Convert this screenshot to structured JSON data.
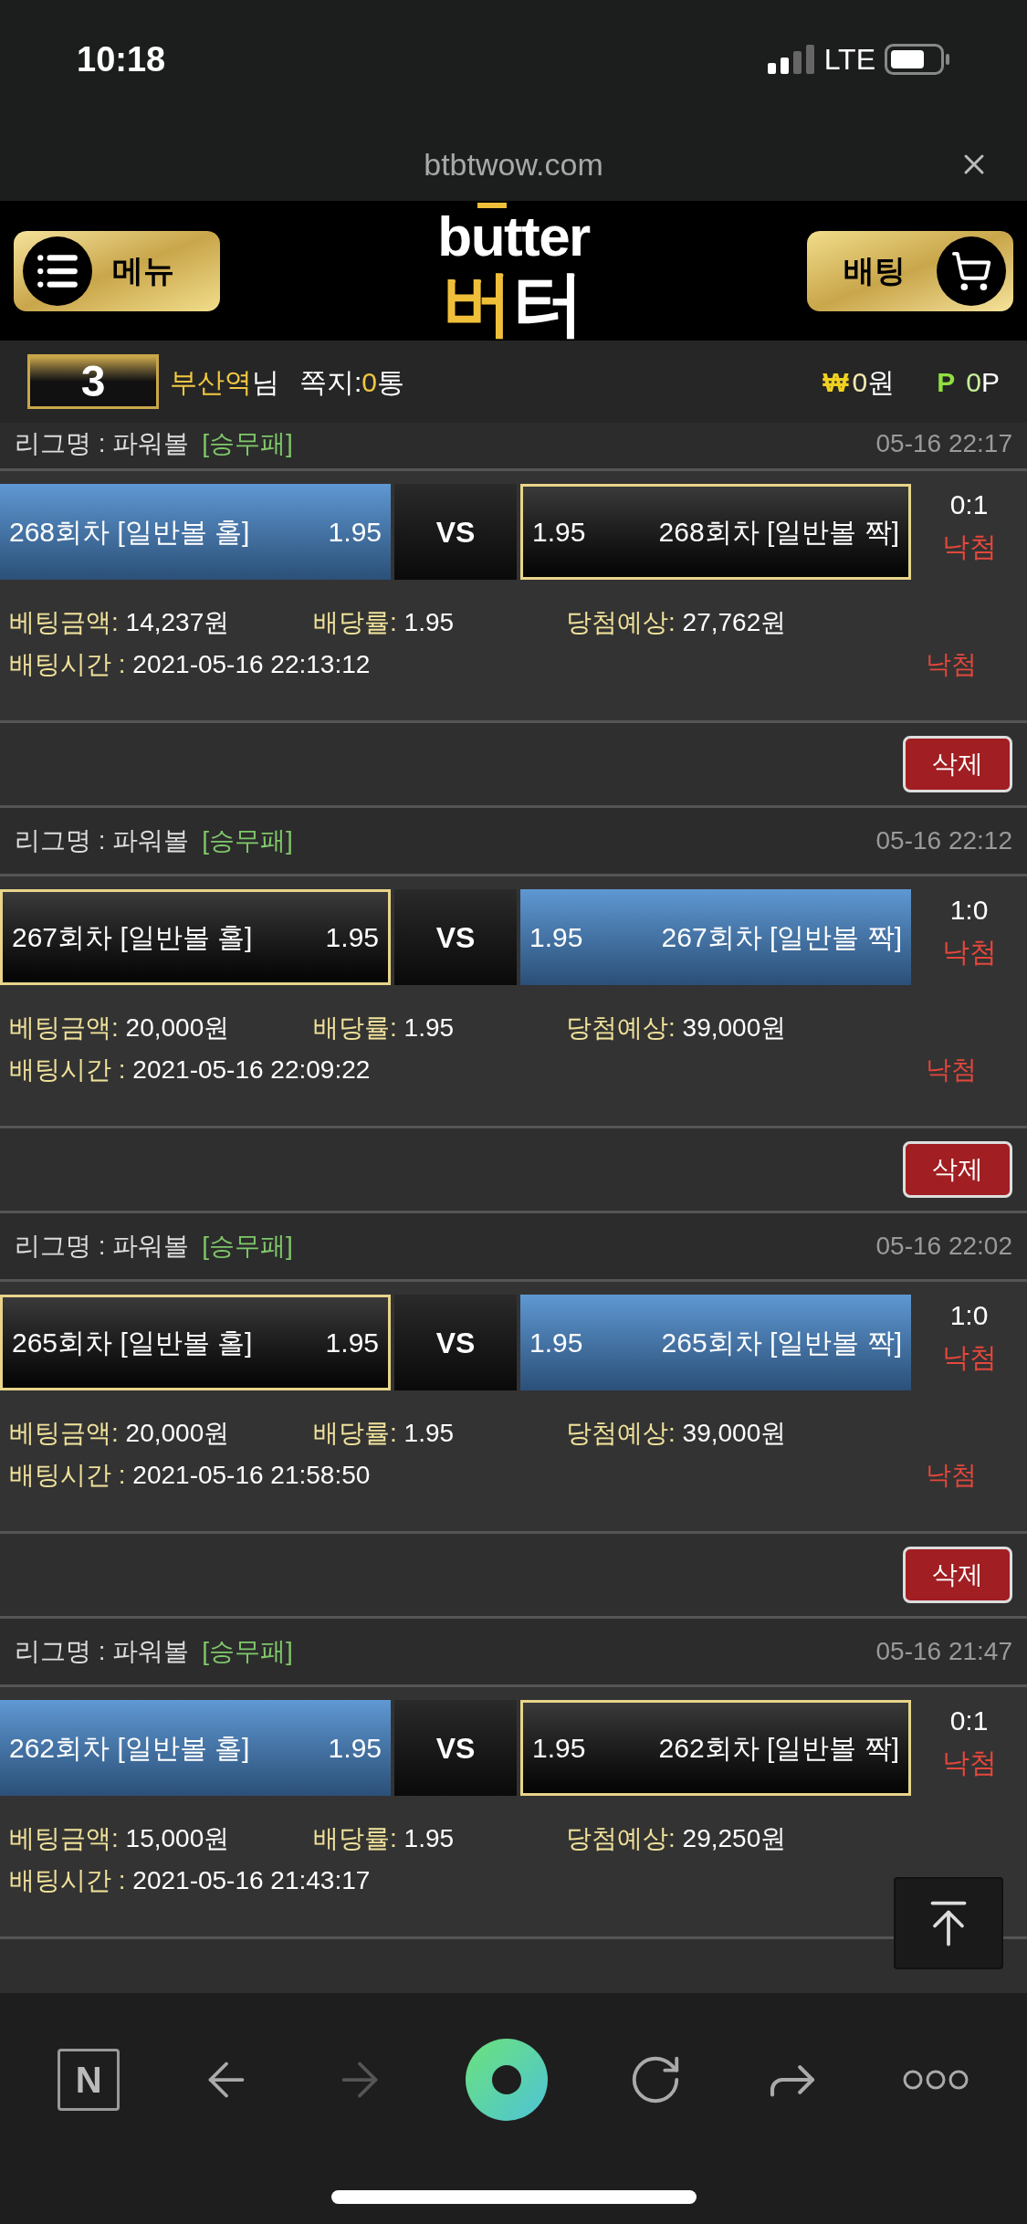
{
  "status_bar": {
    "time": "10:18",
    "network": "LTE"
  },
  "browser": {
    "url": "btbtwow.com"
  },
  "header": {
    "menu_button": "메뉴",
    "logo_top": "butter",
    "logo_bottom": [
      "버",
      "터"
    ],
    "bet_button": "배팅"
  },
  "user_bar": {
    "level": "3",
    "nickname": "부산역",
    "honorific": "님",
    "messages_label": "쪽지:",
    "messages_count": "0",
    "messages_unit": "통",
    "money_symbol": "₩",
    "money_value": "0",
    "money_unit": "원",
    "points_symbol": "P",
    "points_value": "0",
    "points_unit": "P"
  },
  "bets": [
    {
      "league_label": "리그명 : 파워볼",
      "market": "[승무패]",
      "time": "05-16 22:17",
      "home": {
        "label": "268회차 [일반볼 홀]",
        "odds": "1.95",
        "selected": false
      },
      "vs": "VS",
      "away": {
        "label": "268회차 [일반볼 짝]",
        "odds": "1.95",
        "selected": true
      },
      "score": "0:1",
      "result": "낙첨",
      "amount_label": "베팅금액:",
      "amount": "14,237원",
      "odds_label": "배당률:",
      "odds": "1.95",
      "expected_label": "당첨예상:",
      "expected": "27,762원",
      "bet_time_label": "배팅시간 :",
      "bet_time": "2021-05-16 22:13:12",
      "status": "낙첨",
      "delete": "삭제"
    },
    {
      "league_label": "리그명 : 파워볼",
      "market": "[승무패]",
      "time": "05-16 22:12",
      "home": {
        "label": "267회차 [일반볼 홀]",
        "odds": "1.95",
        "selected": true
      },
      "vs": "VS",
      "away": {
        "label": "267회차 [일반볼 짝]",
        "odds": "1.95",
        "selected": false
      },
      "score": "1:0",
      "result": "낙첨",
      "amount_label": "베팅금액:",
      "amount": "20,000원",
      "odds_label": "배당률:",
      "odds": "1.95",
      "expected_label": "당첨예상:",
      "expected": "39,000원",
      "bet_time_label": "배팅시간 :",
      "bet_time": "2021-05-16 22:09:22",
      "status": "낙첨",
      "delete": "삭제"
    },
    {
      "league_label": "리그명 : 파워볼",
      "market": "[승무패]",
      "time": "05-16 22:02",
      "home": {
        "label": "265회차 [일반볼 홀]",
        "odds": "1.95",
        "selected": true
      },
      "vs": "VS",
      "away": {
        "label": "265회차 [일반볼 짝]",
        "odds": "1.95",
        "selected": false
      },
      "score": "1:0",
      "result": "낙첨",
      "amount_label": "베팅금액:",
      "amount": "20,000원",
      "odds_label": "배당률:",
      "odds": "1.95",
      "expected_label": "당첨예상:",
      "expected": "39,000원",
      "bet_time_label": "배팅시간 :",
      "bet_time": "2021-05-16 21:58:50",
      "status": "낙첨",
      "delete": "삭제"
    },
    {
      "league_label": "리그명 : 파워볼",
      "market": "[승무패]",
      "time": "05-16 21:47",
      "home": {
        "label": "262회차 [일반볼 홀]",
        "odds": "1.95",
        "selected": false
      },
      "vs": "VS",
      "away": {
        "label": "262회차 [일반볼 짝]",
        "odds": "1.95",
        "selected": true
      },
      "score": "0:1",
      "result": "낙첨",
      "amount_label": "베팅금액:",
      "amount": "15,000원",
      "odds_label": "배당률:",
      "odds": "1.95",
      "expected_label": "당첨예상:",
      "expected": "29,250원",
      "bet_time_label": "배팅시간 :",
      "bet_time": "2021-05-16 21:43:17"
    }
  ],
  "bottom_nav": {
    "home_button": "N"
  }
}
